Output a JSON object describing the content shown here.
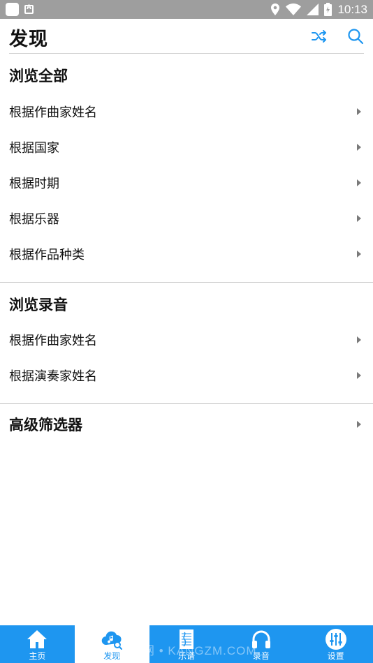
{
  "status_bar": {
    "time": "10:13",
    "icons": [
      "app-icon",
      "text-app-icon",
      "location-icon",
      "wifi-icon",
      "signal-icon",
      "battery-icon"
    ]
  },
  "header": {
    "title": "发现",
    "actions": [
      "shuffle-icon",
      "search-icon"
    ]
  },
  "browse_all": {
    "title": "浏览全部",
    "items": [
      {
        "label": "根据作曲家姓名"
      },
      {
        "label": "根据国家"
      },
      {
        "label": "根据时期"
      },
      {
        "label": "根据乐器"
      },
      {
        "label": "根据作品种类"
      }
    ]
  },
  "browse_recordings": {
    "title": "浏览录音",
    "items": [
      {
        "label": "根据作曲家姓名"
      },
      {
        "label": "根据演奏家姓名"
      }
    ]
  },
  "advanced_filter": {
    "title": "高级筛选器"
  },
  "bottom_nav": {
    "items": [
      {
        "label": "主页",
        "icon": "home-icon"
      },
      {
        "label": "发现",
        "icon": "discover-icon",
        "active": true
      },
      {
        "label": "乐谱",
        "icon": "sheet-music-icon"
      },
      {
        "label": "录音",
        "icon": "headphones-icon"
      },
      {
        "label": "设置",
        "icon": "settings-sliders-icon"
      }
    ]
  },
  "watermark": "下载网 • KANGZM.COM",
  "colors": {
    "accent": "#1e96f0",
    "status_bar": "#9e9e9e",
    "divider": "#c8c8c8"
  }
}
